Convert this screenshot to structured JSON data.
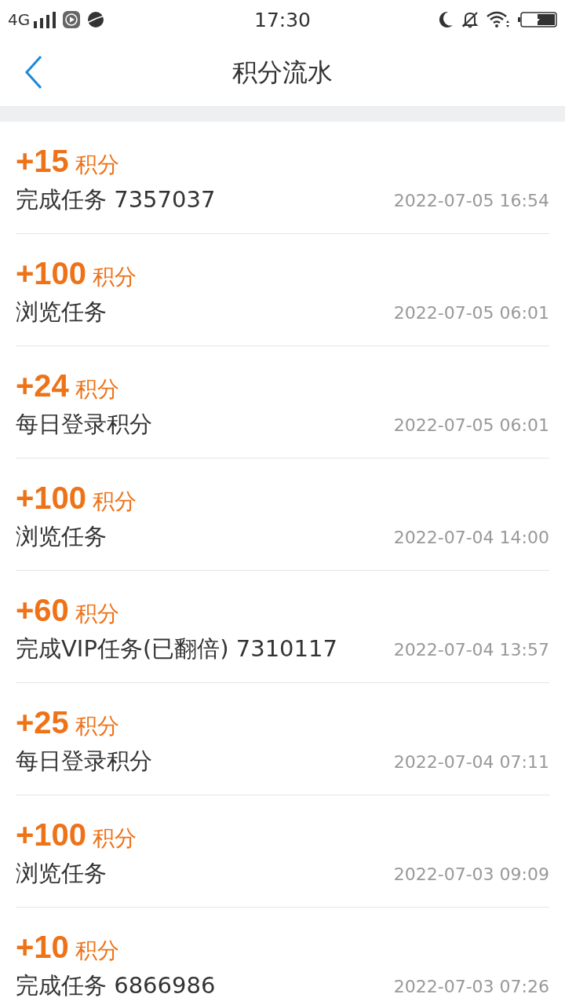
{
  "status_bar": {
    "network": "4G",
    "time": "17:30"
  },
  "header": {
    "title": "积分流水"
  },
  "records": [
    {
      "amount": "+15",
      "unit": "积分",
      "description": "完成任务 7357037",
      "time": "2022-07-05 16:54"
    },
    {
      "amount": "+100",
      "unit": "积分",
      "description": "浏览任务",
      "time": "2022-07-05 06:01"
    },
    {
      "amount": "+24",
      "unit": "积分",
      "description": "每日登录积分",
      "time": "2022-07-05 06:01"
    },
    {
      "amount": "+100",
      "unit": "积分",
      "description": "浏览任务",
      "time": "2022-07-04 14:00"
    },
    {
      "amount": "+60",
      "unit": "积分",
      "description": "完成VIP任务(已翻倍) 7310117",
      "time": "2022-07-04 13:57"
    },
    {
      "amount": "+25",
      "unit": "积分",
      "description": "每日登录积分",
      "time": "2022-07-04 07:11"
    },
    {
      "amount": "+100",
      "unit": "积分",
      "description": "浏览任务",
      "time": "2022-07-03 09:09"
    },
    {
      "amount": "+10",
      "unit": "积分",
      "description": "完成任务 6866986",
      "time": "2022-07-03 07:26"
    }
  ]
}
